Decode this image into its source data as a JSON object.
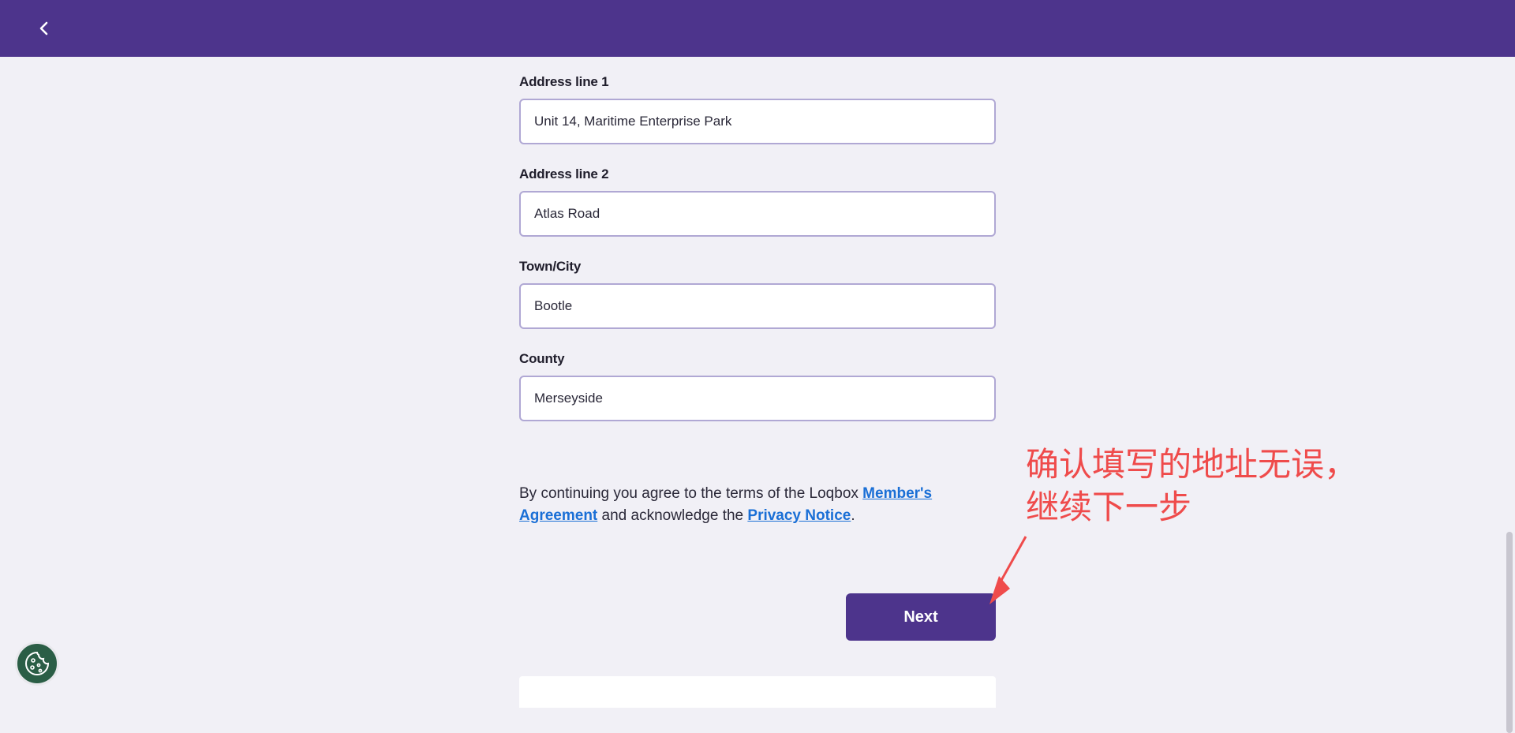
{
  "header": {
    "back_icon": "chevron-left-icon"
  },
  "form": {
    "address_line1": {
      "label": "Address line 1",
      "value": "Unit 14, Maritime Enterprise Park"
    },
    "address_line2": {
      "label": "Address line 2",
      "value": "Atlas Road"
    },
    "town_city": {
      "label": "Town/City",
      "value": "Bootle"
    },
    "county": {
      "label": "County",
      "value": "Merseyside"
    }
  },
  "terms": {
    "prefix": "By continuing you agree to the terms of the Loqbox ",
    "member_agreement_link": "Member's Agreement",
    "middle": " and acknowledge the ",
    "privacy_link": "Privacy Notice",
    "suffix": "."
  },
  "next_button": {
    "label": "Next"
  },
  "annotation": {
    "text": "确认填写的地址无误，\n继续下一步",
    "color": "#ef4b4b"
  },
  "cookie_button": {
    "icon": "cookie-icon"
  },
  "colors": {
    "brand": "#4d348c",
    "background": "#f1f0f6",
    "link": "#1a6fd6",
    "input_border": "#b0a8d4"
  }
}
